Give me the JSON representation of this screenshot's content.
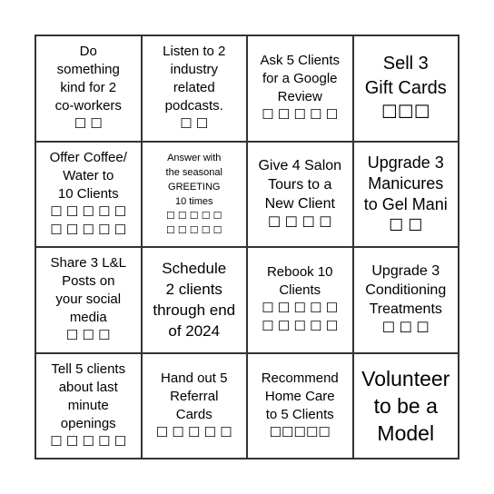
{
  "cells": [
    {
      "text": "Do\nsomething\nkind for 2\nco-workers\n☐ ☐"
    },
    {
      "text": "Listen to 2\nindustry\nrelated\npodcasts.\n☐ ☐"
    },
    {
      "text": "Ask 5 Clients\nfor a Google\nReview\n☐ ☐ ☐ ☐ ☐"
    },
    {
      "text": "Sell 3\nGift Cards\n☐☐☐"
    },
    {
      "text": "Offer Coffee/\nWater to\n10 Clients\n☐ ☐ ☐ ☐ ☐\n☐ ☐ ☐ ☐ ☐"
    },
    {
      "text": "Answer with\nthe seasonal\nGREETING\n10 times\n☐ ☐ ☐ ☐ ☐\n☐ ☐ ☐ ☐ ☐"
    },
    {
      "text": "Give 4 Salon\nTours to a\nNew Client\n☐ ☐ ☐ ☐"
    },
    {
      "text": "Upgrade 3\nManicures\nto Gel Mani\n☐ ☐"
    },
    {
      "text": "Share 3 L&L\nPosts on\nyour social\nmedia\n☐ ☐ ☐"
    },
    {
      "text": "Schedule\n2 clients\nthrough end\nof 2024"
    },
    {
      "text": "Rebook 10\nClients\n☐ ☐ ☐ ☐ ☐\n☐ ☐ ☐ ☐ ☐"
    },
    {
      "text": "Upgrade 3\nConditioning\nTreatments\n☐ ☐ ☐"
    },
    {
      "text": "Tell 5 clients\nabout last\nminute\nopenings\n☐ ☐ ☐ ☐ ☐"
    },
    {
      "text": "Hand out 5\nReferral\nCards\n☐ ☐ ☐ ☐ ☐"
    },
    {
      "text": "Recommend\nHome Care\nto 5 Clients\n☐☐☐☐☐"
    },
    {
      "text": "Volunteer\nto be a\nModel"
    }
  ]
}
